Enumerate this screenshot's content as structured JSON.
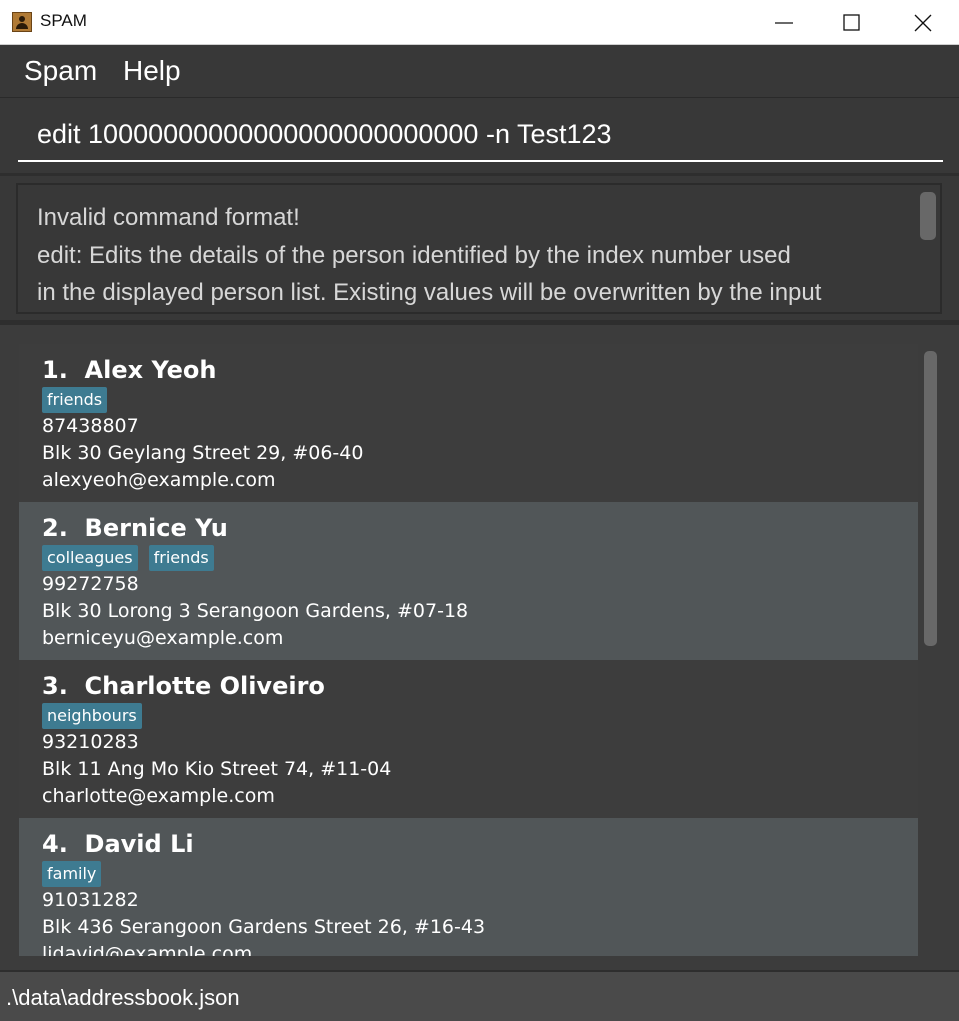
{
  "window": {
    "title": "SPAM",
    "icon": "address-book-icon"
  },
  "menu": {
    "items": [
      {
        "label": "Spam"
      },
      {
        "label": "Help"
      }
    ]
  },
  "command": {
    "value": "edit 10000000000000000000000000 -n Test123"
  },
  "result": {
    "lines": [
      "Invalid command format!",
      "edit: Edits the details of the person identified by the index number used",
      "in the displayed person list. Existing values will be overwritten by the input"
    ]
  },
  "persons": [
    {
      "index": "1.",
      "name": "Alex Yeoh",
      "tags": [
        "friends"
      ],
      "phone": "87438807",
      "address": "Blk 30 Geylang Street 29, #06-40",
      "email": "alexyeoh@example.com"
    },
    {
      "index": "2.",
      "name": "Bernice Yu",
      "tags": [
        "colleagues",
        "friends"
      ],
      "phone": "99272758",
      "address": "Blk 30 Lorong 3 Serangoon Gardens, #07-18",
      "email": "berniceyu@example.com"
    },
    {
      "index": "3.",
      "name": "Charlotte Oliveiro",
      "tags": [
        "neighbours"
      ],
      "phone": "93210283",
      "address": "Blk 11 Ang Mo Kio Street 74, #11-04",
      "email": "charlotte@example.com"
    },
    {
      "index": "4.",
      "name": "David Li",
      "tags": [
        "family"
      ],
      "phone": "91031282",
      "address": "Blk 436 Serangoon Gardens Street 26, #16-43",
      "email": "lidavid@example.com"
    }
  ],
  "status": {
    "path": ".\\data\\addressbook.json"
  },
  "colors": {
    "background": "#383838",
    "card_odd": "#3d3d3d",
    "card_even": "#515658",
    "tag": "#3e7b91"
  }
}
